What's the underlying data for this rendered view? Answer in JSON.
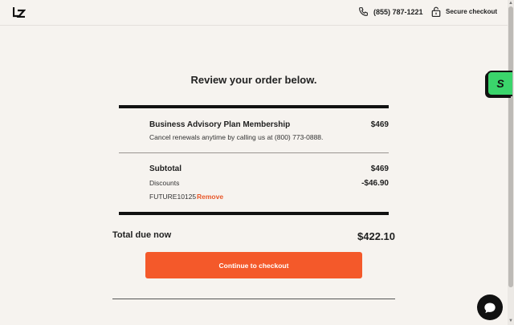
{
  "header": {
    "logo_text": "LZ",
    "phone": "(855) 787-1221",
    "secure_label": "Secure checkout"
  },
  "side_badge": {
    "text": "S",
    "color": "#3ad56b"
  },
  "main": {
    "title": "Review your order below.",
    "item": {
      "name": "Business Advisory Plan Membership",
      "price": "$469",
      "description": "Cancel renewals anytime by calling us at (800) 773-0888."
    },
    "subtotal_label": "Subtotal",
    "subtotal_value": "$469",
    "discounts_label": "Discounts",
    "discounts_value": "-$46.90",
    "promo_code": "FUTURE10125",
    "remove_label": "Remove",
    "total_label": "Total due now",
    "total_value": "$422.10",
    "checkout_label": "Continue to checkout"
  },
  "colors": {
    "accent": "#f4592a",
    "background": "#f6f3ef"
  },
  "icons": {
    "phone": "phone-icon",
    "lock": "lock-icon",
    "chat": "chat-icon"
  }
}
